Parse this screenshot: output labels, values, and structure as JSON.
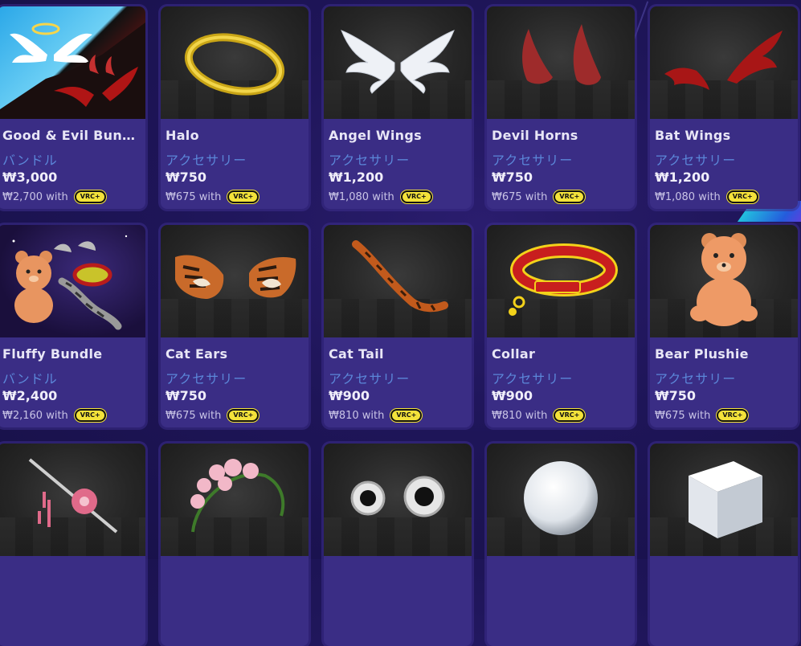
{
  "currency_symbol": "₩",
  "vrc_plus_badge": "VRC+",
  "colors": {
    "background": "#1e1558",
    "card": "#3a2d85",
    "category_text": "#5b86d8",
    "badge": "#f3e23a"
  },
  "items": [
    {
      "name": "Good & Evil Bundle",
      "category": "バンドル",
      "price": "₩3,000",
      "vrc_price": "₩2,700 with",
      "icon": "good-evil-bundle-thumbnail"
    },
    {
      "name": "Halo",
      "category": "アクセサリー",
      "price": "₩750",
      "vrc_price": "₩675 with",
      "icon": "halo-thumbnail"
    },
    {
      "name": "Angel Wings",
      "category": "アクセサリー",
      "price": "₩1,200",
      "vrc_price": "₩1,080 with",
      "icon": "angel-wings-thumbnail"
    },
    {
      "name": "Devil Horns",
      "category": "アクセサリー",
      "price": "₩750",
      "vrc_price": "₩675 with",
      "icon": "devil-horns-thumbnail"
    },
    {
      "name": "Bat Wings",
      "category": "アクセサリー",
      "price": "₩1,200",
      "vrc_price": "₩1,080 with",
      "icon": "bat-wings-thumbnail"
    },
    {
      "name": "Fluffy Bundle",
      "category": "バンドル",
      "price": "₩2,400",
      "vrc_price": "₩2,160 with",
      "icon": "fluffy-bundle-thumbnail"
    },
    {
      "name": "Cat Ears",
      "category": "アクセサリー",
      "price": "₩750",
      "vrc_price": "₩675 with",
      "icon": "cat-ears-thumbnail"
    },
    {
      "name": "Cat Tail",
      "category": "アクセサリー",
      "price": "₩900",
      "vrc_price": "₩810 with",
      "icon": "cat-tail-thumbnail"
    },
    {
      "name": "Collar",
      "category": "アクセサリー",
      "price": "₩900",
      "vrc_price": "₩810 with",
      "icon": "collar-thumbnail"
    },
    {
      "name": "Bear Plushie",
      "category": "アクセサリー",
      "price": "₩750",
      "vrc_price": "₩675 with",
      "icon": "bear-plushie-thumbnail"
    },
    {
      "icon": "hair-pin-thumbnail"
    },
    {
      "icon": "flower-crown-thumbnail"
    },
    {
      "icon": "googly-eyes-thumbnail"
    },
    {
      "icon": "sphere-thumbnail"
    },
    {
      "icon": "cube-thumbnail"
    }
  ]
}
